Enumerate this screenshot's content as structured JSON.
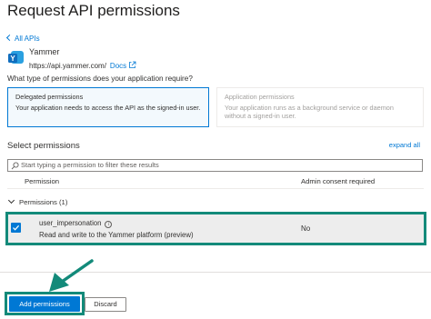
{
  "header": {
    "title": "Request API permissions"
  },
  "nav": {
    "back_label": "All APIs"
  },
  "api": {
    "name": "Yammer",
    "url": "https://api.yammer.com/",
    "docs_label": "Docs",
    "icon": "yammer-logo"
  },
  "question": "What type of permissions does your application require?",
  "permission_types": [
    {
      "title": "Delegated permissions",
      "description": "Your application needs to access the API as the signed-in user.",
      "selected": true
    },
    {
      "title": "Application permissions",
      "description": "Your application runs as a background service or daemon without a signed-in user.",
      "selected": false
    }
  ],
  "select_permissions": {
    "label": "Select permissions",
    "expand_all": "expand all",
    "filter_placeholder": "Start typing a permission to filter these results"
  },
  "table": {
    "columns": [
      "Permission",
      "Admin consent required"
    ],
    "group": "Permissions (1)",
    "rows": [
      {
        "name": "user_impersonation",
        "description": "Read and write to the Yammer platform (preview)",
        "admin_consent": "No",
        "checked": true
      }
    ]
  },
  "footer": {
    "add_label": "Add permissions",
    "discard_label": "Discard"
  },
  "colors": {
    "accent": "#0078d4",
    "highlight": "#138a7a"
  }
}
